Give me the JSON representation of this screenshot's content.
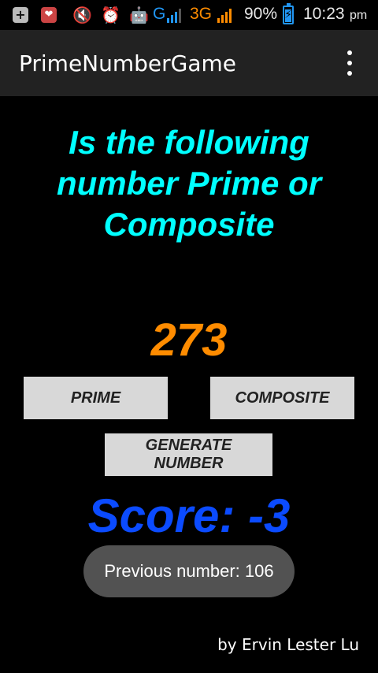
{
  "status_bar": {
    "icons": [
      "notification-plus-icon",
      "lips-icon",
      "mute-icon",
      "alarm-icon",
      "android-icon"
    ],
    "network_1": "G",
    "network_2": "3G",
    "battery": "90%",
    "battery_level": 0.9,
    "time": "10:23",
    "ampm": "pm",
    "colors": {
      "network_1": "#2196f3",
      "network_2": "#ff8c00",
      "battery": "#2196f3"
    }
  },
  "action_bar": {
    "title": "PrimeNumberGame",
    "overflow_icon": "overflow-menu-icon"
  },
  "game": {
    "question": "Is the following number Prime or Composite",
    "number": "273",
    "prime_button": "PRIME",
    "composite_button": "COMPOSITE",
    "generate_button": "GENERATE NUMBER",
    "score": "Score: -3",
    "toast": "Previous number: 106",
    "credit": "by Ervin Lester Lu"
  },
  "colors": {
    "question": "#00ffff",
    "number": "#ff8c00",
    "score": "#0b4bff",
    "background": "#000000",
    "action_bar": "#222222",
    "button": "#d8d8d8"
  }
}
